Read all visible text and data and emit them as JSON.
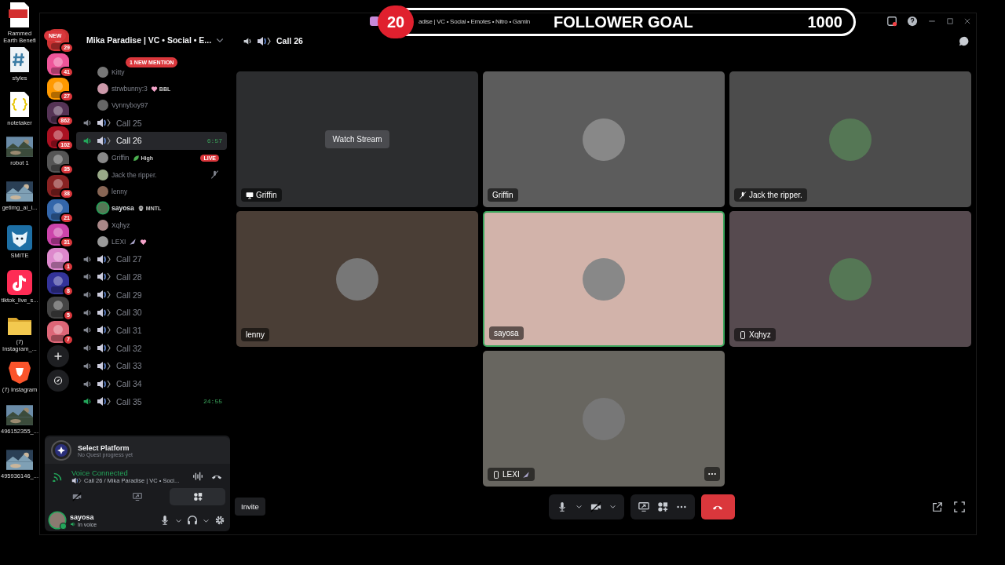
{
  "desktop_icons": [
    {
      "label": "Rammed Earth Benefi",
      "kind": "pdf"
    },
    {
      "label": "styles",
      "kind": "css"
    },
    {
      "label": "notetaker",
      "kind": "json"
    },
    {
      "label": "robot 1",
      "kind": "picture"
    },
    {
      "label": "getimg_ai_i...",
      "kind": "picture"
    },
    {
      "label": "SMITE",
      "kind": "app"
    },
    {
      "label": "tiktok_live_s...",
      "kind": "tiktok"
    },
    {
      "label": "(7) Instagram_...",
      "kind": "folder"
    },
    {
      "label": "(7) Instagram",
      "kind": "browser"
    },
    {
      "label": "496152355_...",
      "kind": "picture"
    },
    {
      "label": "495936146_...",
      "kind": "picture"
    }
  ],
  "window": {
    "title": "adise | VC • Social • Emotes • Nitro • Gamin"
  },
  "follower_goal": {
    "count": "20",
    "label": "FOLLOWER GOAL",
    "target": "1000"
  },
  "servers": [
    {
      "kind": "new",
      "label": "NEW",
      "badge": "29"
    },
    {
      "kind": "server",
      "badge": "41"
    },
    {
      "kind": "server",
      "badge": "27"
    },
    {
      "kind": "server",
      "badge": "862"
    },
    {
      "kind": "server",
      "badge": "102"
    },
    {
      "kind": "server",
      "badge": "35"
    },
    {
      "kind": "server",
      "badge": "38"
    },
    {
      "kind": "server",
      "badge": "21"
    },
    {
      "kind": "server",
      "badge": "31"
    },
    {
      "kind": "server",
      "badge": "1"
    },
    {
      "kind": "server",
      "badge": "8"
    },
    {
      "kind": "server",
      "badge": "5"
    },
    {
      "kind": "server",
      "badge": "7"
    },
    {
      "kind": "add"
    },
    {
      "kind": "discover"
    }
  ],
  "server_header": {
    "name": "Mika Paradise | VC • Social • E..."
  },
  "mention_pill": "1 NEW MENTION",
  "partial_channel_users": [
    {
      "name": "Kitty",
      "muted": false,
      "speaking": false
    },
    {
      "name": "strwbunny:3",
      "tag": "BBL",
      "muted": false,
      "speaking": false
    },
    {
      "name": "Vynnyboy97",
      "muted": false,
      "speaking": false
    }
  ],
  "channels": [
    {
      "name": "Call 25",
      "selected": false,
      "active": false
    },
    {
      "name": "Call 26",
      "selected": true,
      "active": true,
      "timer": "6:57",
      "users": [
        {
          "name": "Griffin",
          "tag": "High",
          "live": "LIVE",
          "muted": false,
          "speaking": false
        },
        {
          "name": "Jack the ripper.",
          "muted": true,
          "speaking": false
        },
        {
          "name": "lenny",
          "muted": false,
          "speaking": false
        },
        {
          "name": "sayosa",
          "tag": "MNTL",
          "muted": false,
          "speaking": true
        },
        {
          "name": "Xqhyz",
          "muted": false,
          "speaking": false
        },
        {
          "name": "LEXI",
          "muted": false,
          "speaking": false
        }
      ]
    },
    {
      "name": "Call 27",
      "selected": false,
      "active": false
    },
    {
      "name": "Call 28",
      "selected": false,
      "active": false
    },
    {
      "name": "Call 29",
      "selected": false,
      "active": false
    },
    {
      "name": "Call 30",
      "selected": false,
      "active": false
    },
    {
      "name": "Call 31",
      "selected": false,
      "active": false
    },
    {
      "name": "Call 32",
      "selected": false,
      "active": false
    },
    {
      "name": "Call 33",
      "selected": false,
      "active": false
    },
    {
      "name": "Call 34",
      "selected": false,
      "active": false
    },
    {
      "name": "Call 35",
      "selected": false,
      "active": true,
      "timer": "24:55"
    }
  ],
  "quest": {
    "title": "Select Platform",
    "subtitle": "No Quest progress yet"
  },
  "voice_status": {
    "title": "Voice Connected",
    "channel": "Call 26 / Mika Paradise | VC • Soci..."
  },
  "user_panel": {
    "name": "sayosa",
    "status": "In voice"
  },
  "call_header": {
    "title": "Call 26"
  },
  "tiles": [
    {
      "name": "Griffin",
      "kind": "stream",
      "color": "#2c2d2f",
      "action": "Watch Stream",
      "speaking": false,
      "muted": false,
      "mobile": false,
      "more": false
    },
    {
      "name": "Griffin",
      "kind": "avatar",
      "color": "#5c5c5c",
      "speaking": false,
      "muted": false,
      "mobile": false,
      "more": false
    },
    {
      "name": "Jack the ripper.",
      "kind": "avatar",
      "color": "#4c4c4c",
      "speaking": false,
      "muted": true,
      "mobile": false,
      "more": false
    },
    {
      "name": "lenny",
      "kind": "avatar",
      "color": "#4a3e36",
      "speaking": false,
      "muted": false,
      "mobile": false,
      "more": false
    },
    {
      "name": "sayosa",
      "kind": "avatar",
      "color": "#d2b3aa",
      "speaking": true,
      "muted": false,
      "mobile": false,
      "more": false
    },
    {
      "name": "Xqhyz",
      "kind": "avatar",
      "color": "#564a4f",
      "speaking": false,
      "muted": false,
      "mobile": true,
      "more": false
    },
    {
      "name": "LEXI",
      "kind": "avatar",
      "color": "#686660",
      "speaking": false,
      "muted": false,
      "mobile": true,
      "more": true
    }
  ],
  "invite_button": "Invite"
}
